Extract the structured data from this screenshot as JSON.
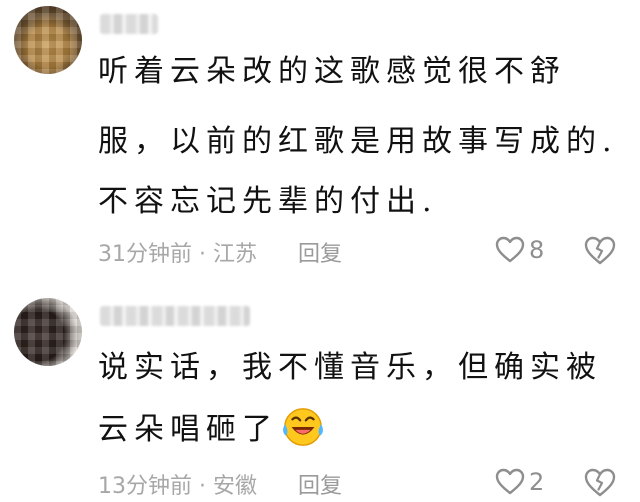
{
  "comments": [
    {
      "text_lines": [
        "听着云朵改的这歌感觉很不舒",
        "服，以前的红歌是用故事写成的.",
        "不容忘记先辈的付出."
      ],
      "time": "31分钟前",
      "location": "江苏",
      "reply_label": "回复",
      "like_count": "8",
      "avatar_icon": "user-avatar-blurred",
      "like_icon": "heart-outline-icon",
      "dislike_icon": "broken-heart-icon"
    },
    {
      "text_lines": [
        "说实话，我不懂音乐，但确实被",
        "云朵唱砸了"
      ],
      "emoji": "laughing-crying-emoji-icon",
      "time": "13分钟前",
      "location": "安徽",
      "reply_label": "回复",
      "like_count": "2",
      "avatar_icon": "user-avatar-blurred",
      "like_icon": "heart-outline-icon",
      "dislike_icon": "broken-heart-icon"
    }
  ],
  "colors": {
    "text": "#111111",
    "meta": "#a7a7a7",
    "icon": "#8e8e8e",
    "emoji_face": "#ffc81e"
  }
}
